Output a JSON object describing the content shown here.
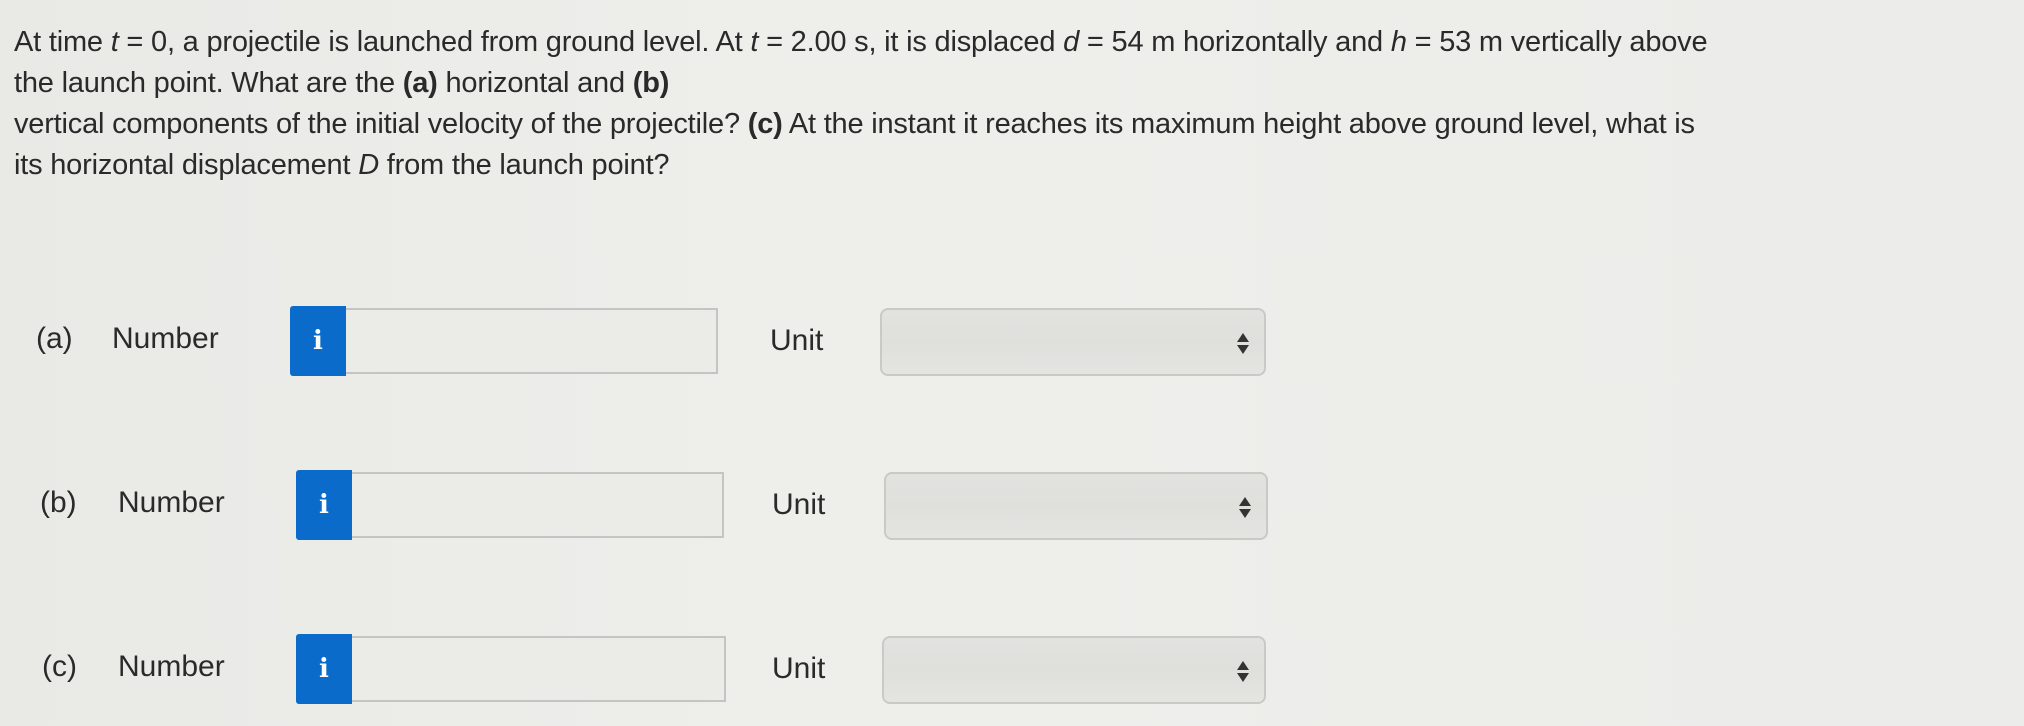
{
  "question": {
    "line1_a": "At time ",
    "var_t": "t",
    "eq_t0": " = 0, a projectile is launched from ground level. At ",
    "eq_t2": " = 2.00 s, it is displaced ",
    "var_d": "d",
    "eq_d": " = 54 m horizontally and ",
    "var_h": "h",
    "eq_h": " = 53 m vertically above",
    "line2": "the launch point. What are the ",
    "part_a": "(a)",
    "line2_b": " horizontal and ",
    "part_b": "(b)",
    "line3": "vertical components of the initial velocity of the projectile? ",
    "part_c": "(c)",
    "line3_b": " At the instant it reaches its maximum height above ground level, what is",
    "line4": "its horizontal displacement ",
    "var_D": "D",
    "line4_b": " from the launch point?"
  },
  "answers": [
    {
      "part": "(a)",
      "number_label": "Number",
      "info_icon": "i",
      "number_value": "",
      "unit_label": "Unit",
      "unit_value": ""
    },
    {
      "part": "(b)",
      "number_label": "Number",
      "info_icon": "i",
      "number_value": "",
      "unit_label": "Unit",
      "unit_value": ""
    },
    {
      "part": "(c)",
      "number_label": "Number",
      "info_icon": "i",
      "number_value": "",
      "unit_label": "Unit",
      "unit_value": ""
    }
  ],
  "colors": {
    "info_button": "#0b6bcb"
  }
}
